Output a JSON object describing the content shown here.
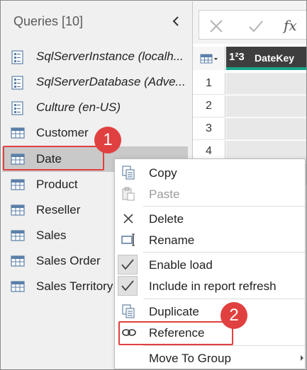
{
  "queries_pane": {
    "header": "Queries [10]",
    "collapse_icon": "chevron-left-icon",
    "items": [
      {
        "label": "SqlServerInstance (localh...",
        "icon": "parameter-icon",
        "italic": true
      },
      {
        "label": "SqlServerDatabase (Adve...",
        "icon": "parameter-icon",
        "italic": true
      },
      {
        "label": "Culture (en-US)",
        "icon": "parameter-icon",
        "italic": true
      },
      {
        "label": "Customer",
        "icon": "table-icon",
        "italic": false
      },
      {
        "label": "Date",
        "icon": "table-icon",
        "italic": false,
        "selected": true
      },
      {
        "label": "Product",
        "icon": "table-icon",
        "italic": false
      },
      {
        "label": "Reseller",
        "icon": "table-icon",
        "italic": false
      },
      {
        "label": "Sales",
        "icon": "table-icon",
        "italic": false
      },
      {
        "label": "Sales Order",
        "icon": "table-icon",
        "italic": false
      },
      {
        "label": "Sales Territory",
        "icon": "table-icon",
        "italic": false
      }
    ]
  },
  "formula_bar": {
    "cancel_icon": "close-icon",
    "commit_icon": "checkmark-icon",
    "fx_label": "fx"
  },
  "grid": {
    "type_icon": "1²3",
    "column_header": "DateKey",
    "row_numbers": [
      "1",
      "2",
      "3",
      "4"
    ],
    "accent_color": "#19a58a"
  },
  "context_menu": {
    "items": [
      {
        "label": "Copy",
        "icon": "copy-icon"
      },
      {
        "label": "Paste",
        "icon": "paste-icon",
        "disabled": true
      },
      {
        "label": "Delete",
        "icon": "delete-icon"
      },
      {
        "label": "Rename",
        "icon": "rename-icon"
      },
      {
        "label": "Enable load",
        "icon": "checkmark-icon",
        "checked": true
      },
      {
        "label": "Include in report refresh",
        "icon": "checkmark-icon",
        "checked": true
      },
      {
        "label": "Duplicate",
        "icon": "duplicate-icon"
      },
      {
        "label": "Reference",
        "icon": "link-icon"
      },
      {
        "label": "Move To Group",
        "icon": "",
        "submenu": true
      }
    ]
  },
  "annotations": {
    "badge_1": "1",
    "badge_2": "2",
    "color": "#e0403f"
  }
}
